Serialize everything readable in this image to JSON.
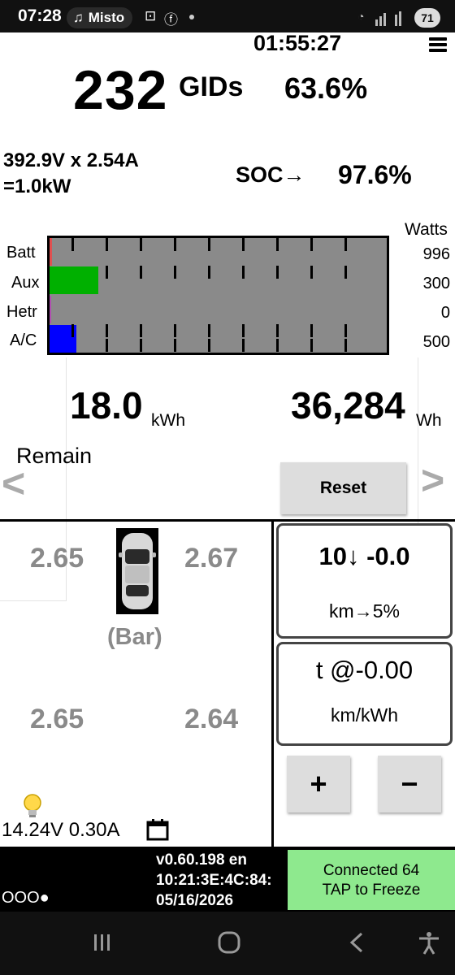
{
  "status_bar": {
    "time": "07:28",
    "media_label": "Misto",
    "battery": "71"
  },
  "header": {
    "clock": "01:55:27",
    "gids_value": "232",
    "gids_unit": "GIDs",
    "gids_percent": "63.6%"
  },
  "power": {
    "line1": "392.9V x 2.54A",
    "line2": "=1.0kW",
    "soc_label": "SOC→",
    "soc_value": "97.6%"
  },
  "load_chart": {
    "watts_header": "Watts",
    "rows": [
      {
        "label": "Batt",
        "watts": "996",
        "color": "#e05050"
      },
      {
        "label": "Aux",
        "watts": "300",
        "color": "#00b000"
      },
      {
        "label": "Hetr",
        "watts": "0",
        "color": "#b050b0"
      },
      {
        "label": "A/C",
        "watts": "500",
        "color": "#0000ff"
      }
    ]
  },
  "energy": {
    "remain_value": "18.0",
    "remain_unit": "kWh",
    "remain_label": "Remain",
    "total_value": "36,284",
    "total_unit": "Wh",
    "reset_label": "Reset"
  },
  "tires": {
    "front_left": "2.65",
    "front_right": "2.67",
    "rear_left": "2.65",
    "rear_right": "2.64",
    "unit": "(Bar)"
  },
  "range": {
    "line1": "10↓ -0.0",
    "line2": "km→5%"
  },
  "efficiency": {
    "line1": "t @-0.00",
    "line2": "km/kWh"
  },
  "buttons": {
    "plus": "+",
    "minus": "−"
  },
  "aux_battery": {
    "reading": "14.24V 0.30A"
  },
  "footer": {
    "indicator": "OOO●",
    "version": "v0.60.198 en",
    "mac": "10:21:3E:4C:84:",
    "date": "05/16/2026",
    "connected_line1": "Connected 64",
    "connected_line2": "TAP to Freeze"
  },
  "colors": {
    "chart_background": "#8a8a8a",
    "connected_background": "#8ee98e",
    "tire_text": "#8a8a8a"
  }
}
